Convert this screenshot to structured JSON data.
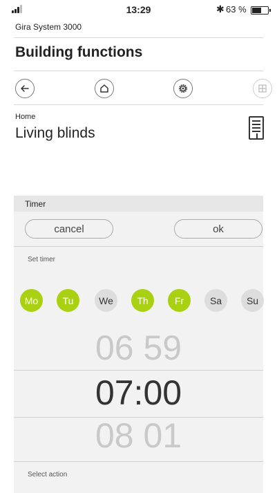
{
  "status": {
    "time": "13:29",
    "bluetooth": "✱",
    "battery_percent": "63 %",
    "battery_level": 0.63
  },
  "app": {
    "title": "Gira System 3000"
  },
  "section": {
    "title": "Building functions"
  },
  "nav": {
    "icons": [
      "back-arrow-icon",
      "home-icon",
      "gear-icon",
      "grid-icon"
    ]
  },
  "device": {
    "breadcrumb": "Home",
    "title": "Living blinds",
    "icon": "blinds-icon"
  },
  "timer": {
    "header": "Timer",
    "cancel_label": "cancel",
    "ok_label": "ok",
    "set_timer_label": "Set timer",
    "days": [
      {
        "label": "Mo",
        "active": true
      },
      {
        "label": "Tu",
        "active": true
      },
      {
        "label": "We",
        "active": false
      },
      {
        "label": "Th",
        "active": true
      },
      {
        "label": "Fr",
        "active": true
      },
      {
        "label": "Sa",
        "active": false
      },
      {
        "label": "Su",
        "active": false
      }
    ],
    "picker": {
      "prev": "06 59",
      "current": "07:00",
      "next": "08 01"
    },
    "select_action_label": "Select action"
  },
  "colors": {
    "accent": "#a9d011",
    "inactive_day": "#dddddd",
    "panel": "#f2f2f2"
  }
}
